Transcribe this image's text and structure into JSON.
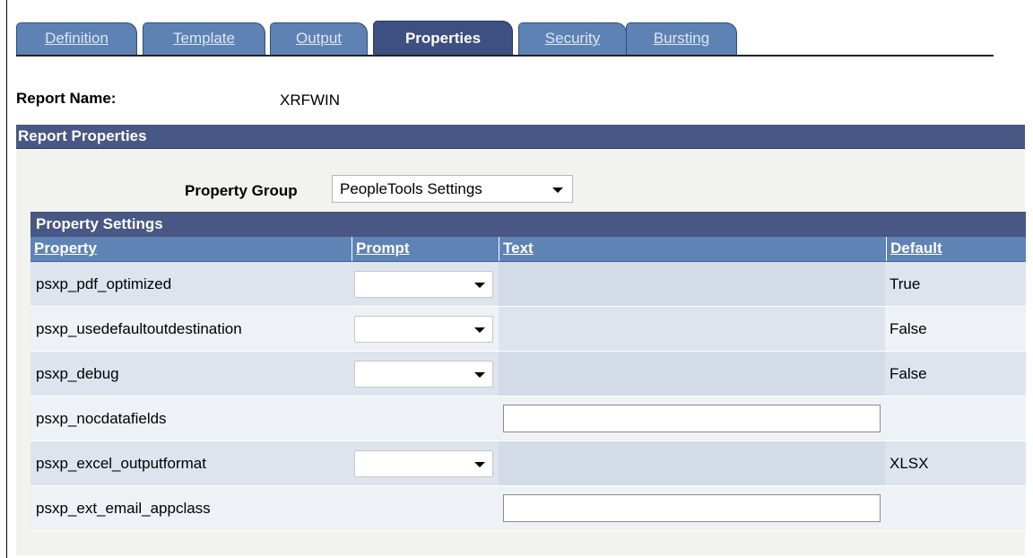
{
  "tabs": [
    {
      "label": "Definition",
      "active": false
    },
    {
      "label": "Template",
      "active": false
    },
    {
      "label": "Output",
      "active": false
    },
    {
      "label": "Properties",
      "active": true
    },
    {
      "label": "Security",
      "active": false
    },
    {
      "label": "Bursting",
      "active": false
    }
  ],
  "report": {
    "name_label": "Report Name:",
    "name_value": "XRFWIN"
  },
  "section": {
    "title": "Report Properties",
    "property_group_label": "Property Group",
    "property_group_value": "PeopleTools Settings"
  },
  "grid": {
    "title": "Property Settings",
    "columns": {
      "property": "Property",
      "prompt": "Prompt",
      "text": "Text",
      "default": "Default"
    },
    "rows": [
      {
        "property": "psxp_pdf_optimized",
        "prompt": "",
        "text": "",
        "default": "True"
      },
      {
        "property": "psxp_usedefaultoutdestination",
        "prompt": "",
        "text": "",
        "default": "False"
      },
      {
        "property": "psxp_debug",
        "prompt": "",
        "text": "",
        "default": "False"
      },
      {
        "property": "psxp_nocdatafields",
        "prompt": "",
        "text": "",
        "default": ""
      },
      {
        "property": "psxp_excel_outputformat",
        "prompt": "",
        "text": "",
        "default": "XLSX"
      },
      {
        "property": "psxp_ext_email_appclass",
        "prompt": "",
        "text": "",
        "default": ""
      }
    ]
  },
  "colors": {
    "tab": "#5f82b4",
    "tab_active": "#3e4f82",
    "section_header": "#485783",
    "grid_header": "#5f83b5"
  }
}
